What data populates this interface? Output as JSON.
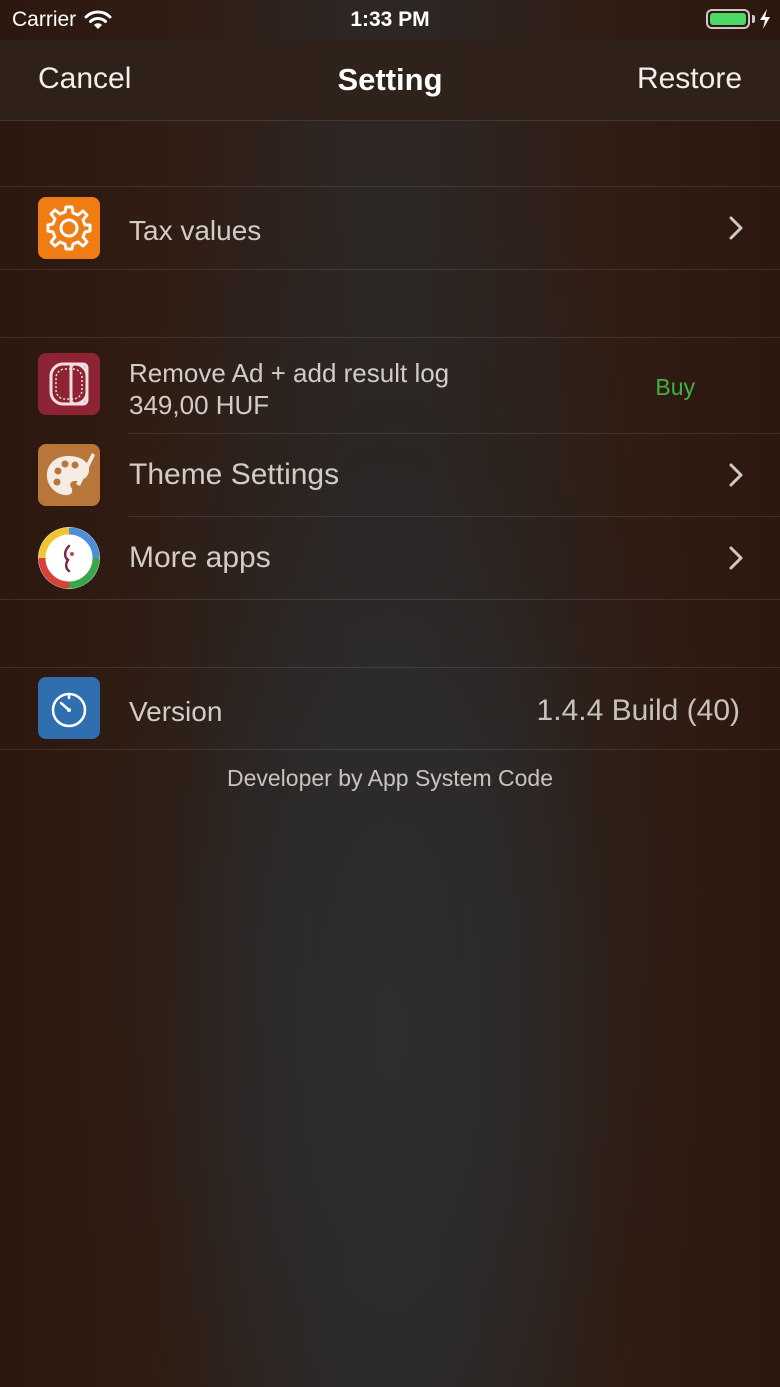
{
  "status_bar": {
    "carrier": "Carrier",
    "time": "1:33 PM",
    "battery_level": 1.0
  },
  "nav": {
    "cancel_label": "Cancel",
    "title": "Setting",
    "restore_label": "Restore"
  },
  "rows": {
    "tax": {
      "label": "Tax values",
      "icon": "gear-icon",
      "icon_color": "#f07c14"
    },
    "remove_ad": {
      "label": "Remove Ad + add result log",
      "price": "349,00 HUF",
      "action": "Buy",
      "icon": "result-log-icon",
      "icon_color": "#8e2433"
    },
    "theme": {
      "label": "Theme Settings",
      "icon": "palette-icon",
      "icon_color": "#b8763a"
    },
    "more_apps": {
      "label": "More apps",
      "icon": "app-system-logo-icon"
    },
    "version": {
      "label": "Version",
      "value": "1.4.4 Build (40)",
      "icon": "timer-icon",
      "icon_color": "#2f6fb0"
    }
  },
  "footer": {
    "text": "Developer by App System Code"
  },
  "colors": {
    "accent_buy": "#3fb24a",
    "background": "#2d2624"
  }
}
